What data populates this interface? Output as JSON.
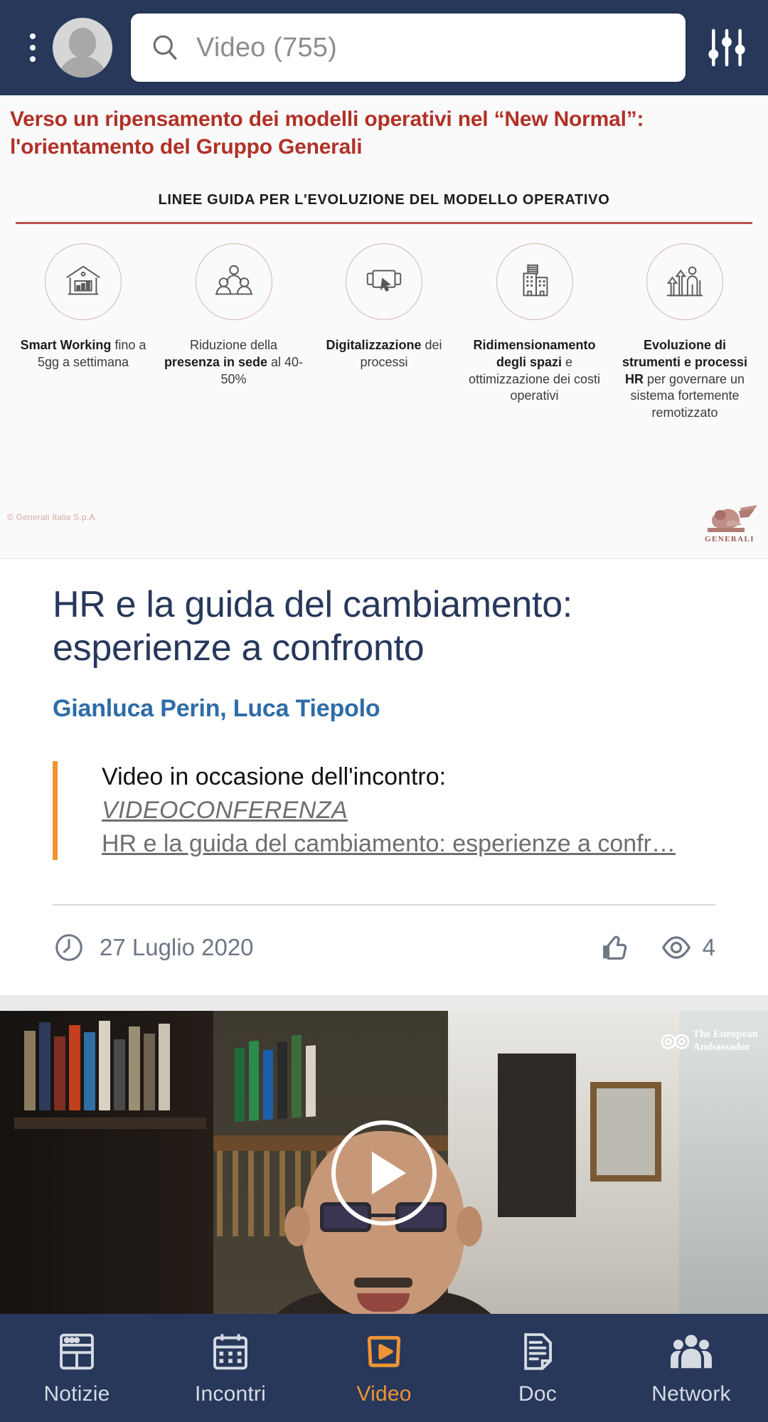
{
  "header": {
    "menu_icon": "kebab-menu-icon",
    "avatar_icon": "user-avatar",
    "search_placeholder": "Video (755)",
    "search_value": "",
    "search_icon": "search-icon",
    "filter_icon": "filter-sliders-icon",
    "background": "#27385b"
  },
  "slide": {
    "title": "Verso un ripensamento dei modelli operativi nel “New Normal”: l'orientamento del Gruppo Generali",
    "subtitle": "LINEE GUIDA PER L'EVOLUZIONE DEL MODELLO OPERATIVO",
    "copyright": "© Generali Italia S.p.A.",
    "logo_name": "GENERALI",
    "title_color": "#b03127",
    "pillars": [
      {
        "icon": "home-office-icon",
        "bold": "Smart Working",
        "rest": " fino a 5gg a settimana"
      },
      {
        "icon": "people-distance-icon",
        "pre": "Riduzione della ",
        "bold": "presenza in sede",
        "rest": " al 40-50%"
      },
      {
        "icon": "digital-screen-icon",
        "bold": "Digitalizzazione",
        "rest": " dei processi"
      },
      {
        "icon": "buildings-icon",
        "bold": "Ridimensionamento degli spazi",
        "rest": " e ottimizzazione dei costi operativi"
      },
      {
        "icon": "growth-person-icon",
        "bold": "Evoluzione di strumenti e processi HR",
        "rest": " per governare un sistema fortemente remotizzato"
      }
    ],
    "controls": [
      {
        "name": "microphone-muted-button",
        "icon": "mic-off-icon",
        "accent": true,
        "badge": false
      },
      {
        "name": "camera-off-button",
        "icon": "camera-off-icon",
        "accent": false,
        "badge": false
      },
      {
        "name": "share-screen-button",
        "icon": "share-up-icon",
        "accent": false,
        "badge": false
      },
      {
        "name": "participants-button",
        "icon": "person-add-icon",
        "accent": false,
        "badge": true
      },
      {
        "name": "chat-button",
        "icon": "chat-bubble-icon",
        "accent": false,
        "badge": true
      },
      {
        "name": "more-options-button",
        "icon": "ellipsis-icon",
        "accent": false,
        "badge": false
      },
      {
        "name": "end-call-button",
        "icon": "close-x-icon",
        "accent": true,
        "badge": false
      }
    ]
  },
  "article": {
    "title": "HR e la guida del cambiamento: esperienze a confronto",
    "authors": "Gianluca Perin, Luca Tiepolo",
    "quote_lead": "Video in occasione dell'incontro:",
    "quote_link": "VIDEOCONFERENZA",
    "quote_link2": "HR e la guida del cambiamento: esperienze a confr…",
    "date": "27 Luglio 2020",
    "clock_icon": "clock-icon",
    "like_icon": "thumbs-up-icon",
    "views_icon": "eye-icon",
    "views_count": "4",
    "accent_bar_color": "#ef9434"
  },
  "next_video": {
    "play_icon": "play-button-icon",
    "watermark_line1": "The European",
    "watermark_line2": "Ambassador"
  },
  "bottom_nav": {
    "active_color": "#ef9434",
    "items": [
      {
        "icon": "news-window-icon",
        "label": "Notizie",
        "active": false
      },
      {
        "icon": "calendar-icon",
        "label": "Incontri",
        "active": false
      },
      {
        "icon": "video-play-icon",
        "label": "Video",
        "active": true
      },
      {
        "icon": "document-icon",
        "label": "Doc",
        "active": false
      },
      {
        "icon": "people-network-icon",
        "label": "Network",
        "active": false
      }
    ]
  }
}
